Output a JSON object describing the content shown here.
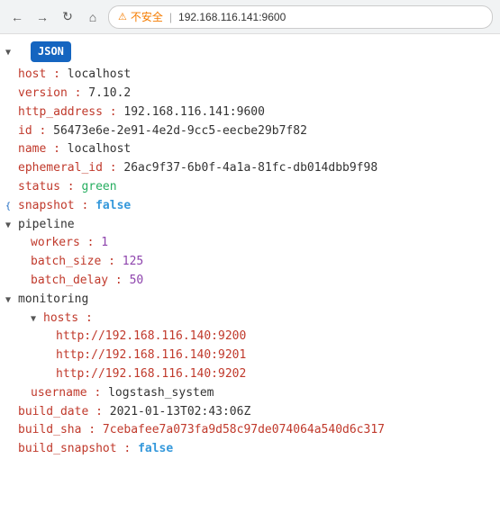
{
  "browser": {
    "url": "192.168.116.141:9600",
    "security_warning": "不安全",
    "back_label": "←",
    "forward_label": "→",
    "refresh_label": "↻",
    "home_label": "⌂"
  },
  "json": {
    "badge": "JSON",
    "host_key": "host :",
    "host_val": "localhost",
    "version_key": "version :",
    "version_val": "7.10.2",
    "http_address_key": "http_address :",
    "http_address_val": "192.168.116.141:9600",
    "id_key": "id :",
    "id_val": "56473e6e-2e91-4e2d-9cc5-eecbe29b7f82",
    "name_key": "name :",
    "name_val": "localhost",
    "ephemeral_id_key": "ephemeral_id :",
    "ephemeral_id_val": "26ac9f37-6b0f-4a1a-81fc-db014dbb9f98",
    "status_key": "status :",
    "status_val": "green",
    "snapshot_key": "snapshot :",
    "snapshot_val": "false",
    "pipeline_label": "pipeline",
    "workers_key": "workers :",
    "workers_val": "1",
    "batch_size_key": "batch_size :",
    "batch_size_val": "125",
    "batch_delay_key": "batch_delay :",
    "batch_delay_val": "50",
    "monitoring_label": "monitoring",
    "hosts_key": "hosts :",
    "host1": "http://192.168.116.140:9200",
    "host2": "http://192.168.116.140:9201",
    "host3": "http://192.168.116.140:9202",
    "username_key": "username :",
    "username_val": "logstash_system",
    "build_date_key": "build_date :",
    "build_date_val": "2021-01-13T02:43:06Z",
    "build_sha_key": "build_sha :",
    "build_sha_val": "7cebafee7a073fa9d58c97de074064a540d6c317",
    "build_snapshot_key": "build_snapshot :",
    "build_snapshot_val": "false"
  }
}
